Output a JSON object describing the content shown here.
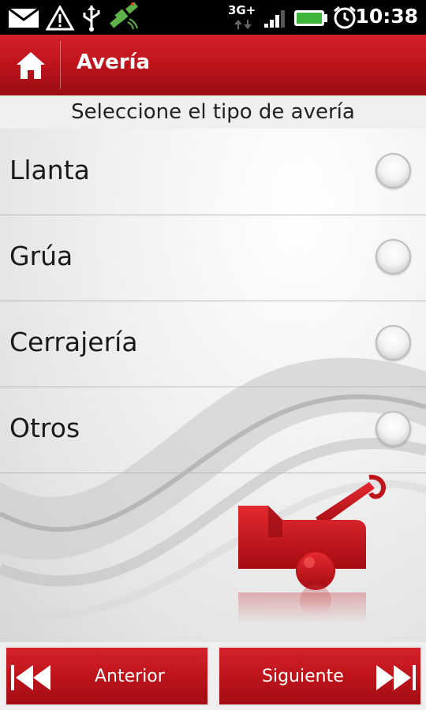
{
  "status_bar": {
    "time": "10:38",
    "network": "3G+",
    "icons": [
      "mail-icon",
      "warning-icon",
      "usb-icon",
      "gps-icon",
      "signal-icon",
      "battery-icon",
      "alarm-icon"
    ]
  },
  "header": {
    "title": "Avería",
    "home_icon": "home-icon"
  },
  "subtitle": "Seleccione el tipo de avería",
  "options": [
    {
      "label": "Llanta",
      "selected": false
    },
    {
      "label": "Grúa",
      "selected": false
    },
    {
      "label": "Cerrajería",
      "selected": false
    },
    {
      "label": "Otros",
      "selected": false
    }
  ],
  "footer": {
    "prev_label": "Anterior",
    "next_label": "Siguiente",
    "prev_icon": "rewind-icon",
    "next_icon": "fast-forward-icon"
  },
  "colors": {
    "brand_red": "#c0141c",
    "background": "#e9e9e9"
  }
}
